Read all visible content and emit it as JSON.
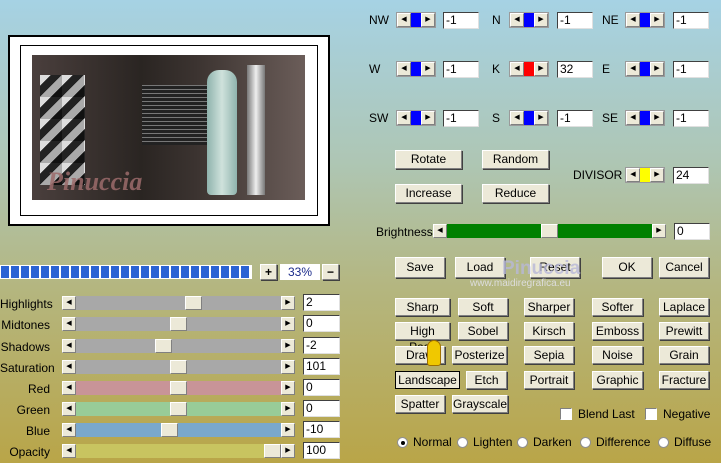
{
  "preview": {
    "zoom": "33%",
    "zoom_in": "+",
    "zoom_out": "−",
    "progress_percent": 100,
    "watermark": "Pinuccia"
  },
  "sliders": [
    {
      "label": "Highlights",
      "value": "2",
      "pos": 0.58,
      "color": "#a8a8a8"
    },
    {
      "label": "Midtones",
      "value": "0",
      "pos": 0.5,
      "color": "#a8a8a8"
    },
    {
      "label": "Shadows",
      "value": "-2",
      "pos": 0.42,
      "color": "#a8a8a8"
    },
    {
      "label": "Saturation",
      "value": "101",
      "pos": 0.5,
      "color": "#a8a8a8"
    },
    {
      "label": "Red",
      "value": "0",
      "pos": 0.5,
      "color": "#c89498"
    },
    {
      "label": "Green",
      "value": "0",
      "pos": 0.5,
      "color": "#98cc98"
    },
    {
      "label": "Blue",
      "value": "-10",
      "pos": 0.45,
      "color": "#7aa8cc"
    },
    {
      "label": "Opacity",
      "value": "100",
      "pos": 1.0,
      "color": "#c8c460"
    }
  ],
  "matrix": [
    {
      "label": "NW",
      "value": "-1",
      "color": "#0000ff"
    },
    {
      "label": "N",
      "value": "-1",
      "color": "#0000ff"
    },
    {
      "label": "NE",
      "value": "-1",
      "color": "#0000ff"
    },
    {
      "label": "W",
      "value": "-1",
      "color": "#0000ff"
    },
    {
      "label": "K",
      "value": "32",
      "color": "#ff0000"
    },
    {
      "label": "E",
      "value": "-1",
      "color": "#0000ff"
    },
    {
      "label": "SW",
      "value": "-1",
      "color": "#0000ff"
    },
    {
      "label": "S",
      "value": "-1",
      "color": "#0000ff"
    },
    {
      "label": "SE",
      "value": "-1",
      "color": "#0000ff"
    }
  ],
  "tools": {
    "rotate": "Rotate",
    "random": "Random",
    "increase": "Increase",
    "reduce": "Reduce"
  },
  "divisor": {
    "label": "DIVISOR",
    "value": "24",
    "color": "#ffff00"
  },
  "brightness": {
    "label": "Brightness",
    "value": "0",
    "pos": 0.5,
    "color": "#008000"
  },
  "actions": {
    "save": "Save",
    "load": "Load",
    "reset": "Reset",
    "ok": "OK",
    "cancel": "Cancel"
  },
  "watermark": {
    "name": "Pinuccia",
    "url": "www.maidiregrafica.eu"
  },
  "presets": [
    [
      "Sharp",
      "Soft",
      "Sharper",
      "Softer",
      "Laplace"
    ],
    [
      "High Pass",
      "Sobel",
      "Kirsch",
      "Emboss",
      "Prewitt"
    ],
    [
      "Draw",
      "Posterize",
      "Sepia",
      "Noise",
      "Grain"
    ],
    [
      "Landscape",
      "Etch",
      "Portrait",
      "Graphic",
      "Fracture"
    ],
    [
      "Spatter",
      "Grayscale"
    ]
  ],
  "selected_preset": "Landscape",
  "checkboxes": [
    {
      "label": "Blend Last",
      "checked": false
    },
    {
      "label": "Negative",
      "checked": false
    }
  ],
  "blend_modes": [
    {
      "label": "Normal",
      "selected": true
    },
    {
      "label": "Lighten",
      "selected": false
    },
    {
      "label": "Darken",
      "selected": false
    },
    {
      "label": "Difference",
      "selected": false
    },
    {
      "label": "Diffuse",
      "selected": false
    }
  ]
}
